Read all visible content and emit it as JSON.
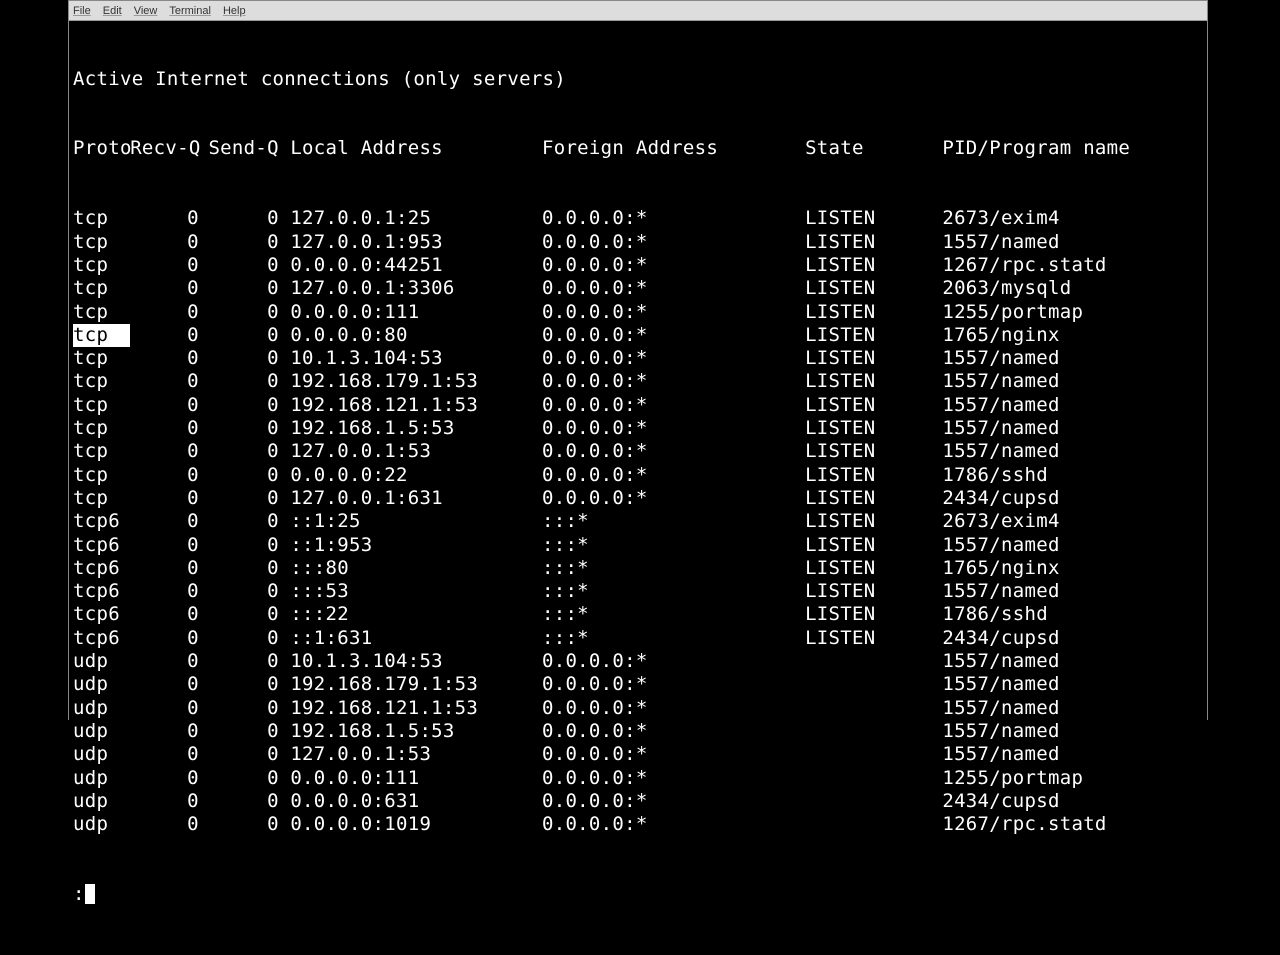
{
  "menubar": {
    "file": "File",
    "edit": "Edit",
    "view": "View",
    "terminal": "Terminal",
    "help": "Help"
  },
  "heading": "Active Internet connections (only servers)",
  "columns": {
    "proto": "Proto",
    "recvq": "Recv-Q",
    "sendq": "Send-Q",
    "local": "Local Address",
    "foreign": "Foreign Address",
    "state": "State",
    "pid": "PID/Program name"
  },
  "rows": [
    {
      "proto": "tcp",
      "recvq": "0",
      "sendq": "0",
      "local": "127.0.0.1:25",
      "foreign": "0.0.0.0:*",
      "state": "LISTEN",
      "pid": "2673/exim4",
      "hl": false
    },
    {
      "proto": "tcp",
      "recvq": "0",
      "sendq": "0",
      "local": "127.0.0.1:953",
      "foreign": "0.0.0.0:*",
      "state": "LISTEN",
      "pid": "1557/named",
      "hl": false
    },
    {
      "proto": "tcp",
      "recvq": "0",
      "sendq": "0",
      "local": "0.0.0.0:44251",
      "foreign": "0.0.0.0:*",
      "state": "LISTEN",
      "pid": "1267/rpc.statd",
      "hl": false
    },
    {
      "proto": "tcp",
      "recvq": "0",
      "sendq": "0",
      "local": "127.0.0.1:3306",
      "foreign": "0.0.0.0:*",
      "state": "LISTEN",
      "pid": "2063/mysqld",
      "hl": false
    },
    {
      "proto": "tcp",
      "recvq": "0",
      "sendq": "0",
      "local": "0.0.0.0:111",
      "foreign": "0.0.0.0:*",
      "state": "LISTEN",
      "pid": "1255/portmap",
      "hl": false
    },
    {
      "proto": "tcp",
      "recvq": "0",
      "sendq": "0",
      "local": "0.0.0.0:80",
      "foreign": "0.0.0.0:*",
      "state": "LISTEN",
      "pid": "1765/nginx",
      "hl": true
    },
    {
      "proto": "tcp",
      "recvq": "0",
      "sendq": "0",
      "local": "10.1.3.104:53",
      "foreign": "0.0.0.0:*",
      "state": "LISTEN",
      "pid": "1557/named",
      "hl": false
    },
    {
      "proto": "tcp",
      "recvq": "0",
      "sendq": "0",
      "local": "192.168.179.1:53",
      "foreign": "0.0.0.0:*",
      "state": "LISTEN",
      "pid": "1557/named",
      "hl": false
    },
    {
      "proto": "tcp",
      "recvq": "0",
      "sendq": "0",
      "local": "192.168.121.1:53",
      "foreign": "0.0.0.0:*",
      "state": "LISTEN",
      "pid": "1557/named",
      "hl": false
    },
    {
      "proto": "tcp",
      "recvq": "0",
      "sendq": "0",
      "local": "192.168.1.5:53",
      "foreign": "0.0.0.0:*",
      "state": "LISTEN",
      "pid": "1557/named",
      "hl": false
    },
    {
      "proto": "tcp",
      "recvq": "0",
      "sendq": "0",
      "local": "127.0.0.1:53",
      "foreign": "0.0.0.0:*",
      "state": "LISTEN",
      "pid": "1557/named",
      "hl": false
    },
    {
      "proto": "tcp",
      "recvq": "0",
      "sendq": "0",
      "local": "0.0.0.0:22",
      "foreign": "0.0.0.0:*",
      "state": "LISTEN",
      "pid": "1786/sshd",
      "hl": false
    },
    {
      "proto": "tcp",
      "recvq": "0",
      "sendq": "0",
      "local": "127.0.0.1:631",
      "foreign": "0.0.0.0:*",
      "state": "LISTEN",
      "pid": "2434/cupsd",
      "hl": false
    },
    {
      "proto": "tcp6",
      "recvq": "0",
      "sendq": "0",
      "local": "::1:25",
      "foreign": ":::*",
      "state": "LISTEN",
      "pid": "2673/exim4",
      "hl": false
    },
    {
      "proto": "tcp6",
      "recvq": "0",
      "sendq": "0",
      "local": "::1:953",
      "foreign": ":::*",
      "state": "LISTEN",
      "pid": "1557/named",
      "hl": false
    },
    {
      "proto": "tcp6",
      "recvq": "0",
      "sendq": "0",
      "local": ":::80",
      "foreign": ":::*",
      "state": "LISTEN",
      "pid": "1765/nginx",
      "hl": false
    },
    {
      "proto": "tcp6",
      "recvq": "0",
      "sendq": "0",
      "local": ":::53",
      "foreign": ":::*",
      "state": "LISTEN",
      "pid": "1557/named",
      "hl": false
    },
    {
      "proto": "tcp6",
      "recvq": "0",
      "sendq": "0",
      "local": ":::22",
      "foreign": ":::*",
      "state": "LISTEN",
      "pid": "1786/sshd",
      "hl": false
    },
    {
      "proto": "tcp6",
      "recvq": "0",
      "sendq": "0",
      "local": "::1:631",
      "foreign": ":::*",
      "state": "LISTEN",
      "pid": "2434/cupsd",
      "hl": false
    },
    {
      "proto": "udp",
      "recvq": "0",
      "sendq": "0",
      "local": "10.1.3.104:53",
      "foreign": "0.0.0.0:*",
      "state": "",
      "pid": "1557/named",
      "hl": false
    },
    {
      "proto": "udp",
      "recvq": "0",
      "sendq": "0",
      "local": "192.168.179.1:53",
      "foreign": "0.0.0.0:*",
      "state": "",
      "pid": "1557/named",
      "hl": false
    },
    {
      "proto": "udp",
      "recvq": "0",
      "sendq": "0",
      "local": "192.168.121.1:53",
      "foreign": "0.0.0.0:*",
      "state": "",
      "pid": "1557/named",
      "hl": false
    },
    {
      "proto": "udp",
      "recvq": "0",
      "sendq": "0",
      "local": "192.168.1.5:53",
      "foreign": "0.0.0.0:*",
      "state": "",
      "pid": "1557/named",
      "hl": false
    },
    {
      "proto": "udp",
      "recvq": "0",
      "sendq": "0",
      "local": "127.0.0.1:53",
      "foreign": "0.0.0.0:*",
      "state": "",
      "pid": "1557/named",
      "hl": false
    },
    {
      "proto": "udp",
      "recvq": "0",
      "sendq": "0",
      "local": "0.0.0.0:111",
      "foreign": "0.0.0.0:*",
      "state": "",
      "pid": "1255/portmap",
      "hl": false
    },
    {
      "proto": "udp",
      "recvq": "0",
      "sendq": "0",
      "local": "0.0.0.0:631",
      "foreign": "0.0.0.0:*",
      "state": "",
      "pid": "2434/cupsd",
      "hl": false
    },
    {
      "proto": "udp",
      "recvq": "0",
      "sendq": "0",
      "local": "0.0.0.0:1019",
      "foreign": "0.0.0.0:*",
      "state": "",
      "pid": "1267/rpc.statd",
      "hl": false
    }
  ],
  "prompt": ":"
}
